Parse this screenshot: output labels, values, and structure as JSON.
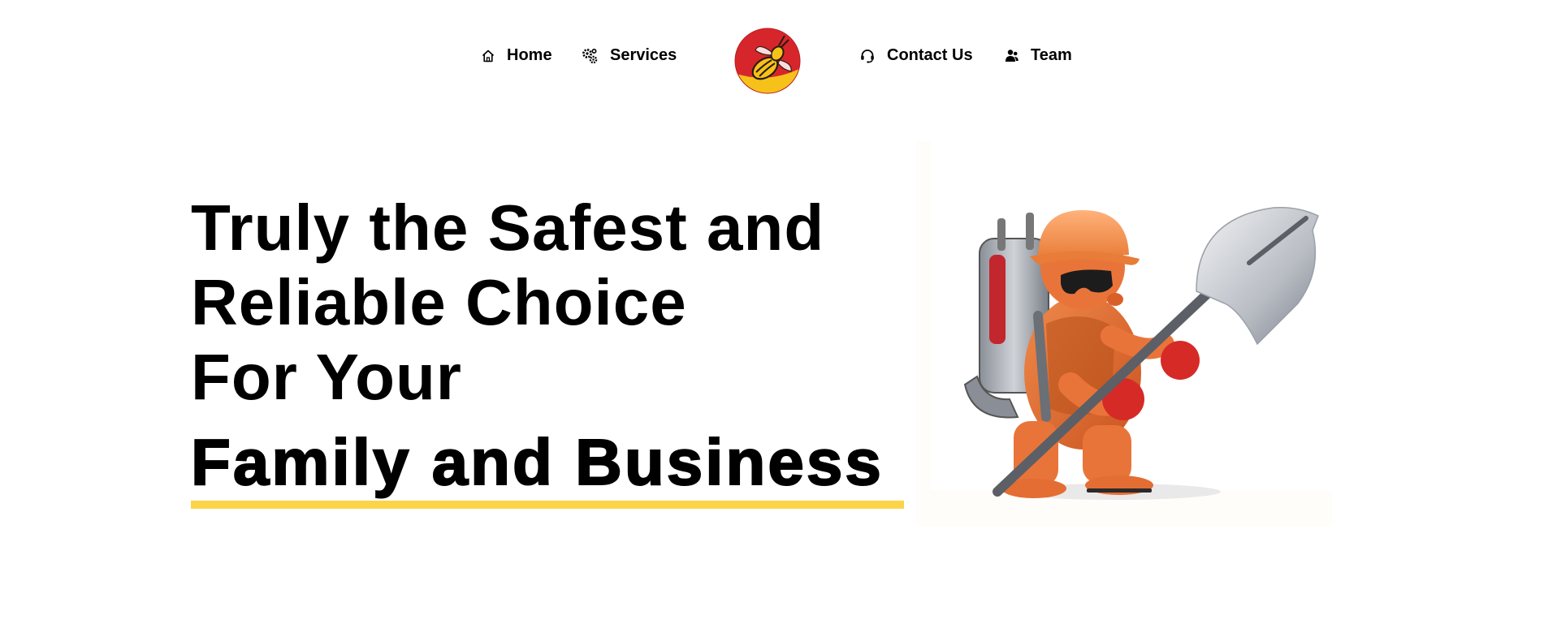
{
  "nav": {
    "items": [
      {
        "label": "Home",
        "icon": "home-icon"
      },
      {
        "label": "Services",
        "icon": "gears-icon"
      },
      {
        "label": "Contact Us",
        "icon": "headset-icon"
      },
      {
        "label": "Team",
        "icon": "users-icon"
      }
    ],
    "logo": {
      "icon": "wasp-logo-icon"
    }
  },
  "hero": {
    "lines": [
      "Truly the Safest and",
      "Reliable Choice",
      "For Your"
    ],
    "emphasis": "Family and Business",
    "underline_color": "#fbd448",
    "image": {
      "icon": "pest-control-worker-illustration"
    }
  },
  "colors": {
    "logo_red": "#d7262b",
    "logo_yellow": "#f6c21a",
    "accent_yellow": "#fbd448",
    "text": "#000000"
  }
}
